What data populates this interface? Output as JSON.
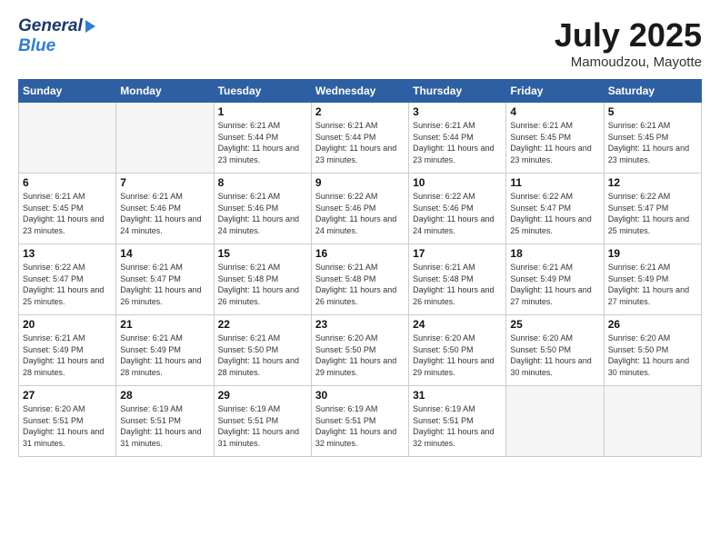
{
  "header": {
    "logo_general": "General",
    "logo_blue": "Blue",
    "month": "July 2025",
    "location": "Mamoudzou, Mayotte"
  },
  "days_of_week": [
    "Sunday",
    "Monday",
    "Tuesday",
    "Wednesday",
    "Thursday",
    "Friday",
    "Saturday"
  ],
  "weeks": [
    [
      {
        "day": "",
        "info": "",
        "empty": true
      },
      {
        "day": "",
        "info": "",
        "empty": true
      },
      {
        "day": "1",
        "info": "Sunrise: 6:21 AM\nSunset: 5:44 PM\nDaylight: 11 hours and 23 minutes."
      },
      {
        "day": "2",
        "info": "Sunrise: 6:21 AM\nSunset: 5:44 PM\nDaylight: 11 hours and 23 minutes."
      },
      {
        "day": "3",
        "info": "Sunrise: 6:21 AM\nSunset: 5:44 PM\nDaylight: 11 hours and 23 minutes."
      },
      {
        "day": "4",
        "info": "Sunrise: 6:21 AM\nSunset: 5:45 PM\nDaylight: 11 hours and 23 minutes."
      },
      {
        "day": "5",
        "info": "Sunrise: 6:21 AM\nSunset: 5:45 PM\nDaylight: 11 hours and 23 minutes."
      }
    ],
    [
      {
        "day": "6",
        "info": "Sunrise: 6:21 AM\nSunset: 5:45 PM\nDaylight: 11 hours and 23 minutes."
      },
      {
        "day": "7",
        "info": "Sunrise: 6:21 AM\nSunset: 5:46 PM\nDaylight: 11 hours and 24 minutes."
      },
      {
        "day": "8",
        "info": "Sunrise: 6:21 AM\nSunset: 5:46 PM\nDaylight: 11 hours and 24 minutes."
      },
      {
        "day": "9",
        "info": "Sunrise: 6:22 AM\nSunset: 5:46 PM\nDaylight: 11 hours and 24 minutes."
      },
      {
        "day": "10",
        "info": "Sunrise: 6:22 AM\nSunset: 5:46 PM\nDaylight: 11 hours and 24 minutes."
      },
      {
        "day": "11",
        "info": "Sunrise: 6:22 AM\nSunset: 5:47 PM\nDaylight: 11 hours and 25 minutes."
      },
      {
        "day": "12",
        "info": "Sunrise: 6:22 AM\nSunset: 5:47 PM\nDaylight: 11 hours and 25 minutes."
      }
    ],
    [
      {
        "day": "13",
        "info": "Sunrise: 6:22 AM\nSunset: 5:47 PM\nDaylight: 11 hours and 25 minutes."
      },
      {
        "day": "14",
        "info": "Sunrise: 6:21 AM\nSunset: 5:47 PM\nDaylight: 11 hours and 26 minutes."
      },
      {
        "day": "15",
        "info": "Sunrise: 6:21 AM\nSunset: 5:48 PM\nDaylight: 11 hours and 26 minutes."
      },
      {
        "day": "16",
        "info": "Sunrise: 6:21 AM\nSunset: 5:48 PM\nDaylight: 11 hours and 26 minutes."
      },
      {
        "day": "17",
        "info": "Sunrise: 6:21 AM\nSunset: 5:48 PM\nDaylight: 11 hours and 26 minutes."
      },
      {
        "day": "18",
        "info": "Sunrise: 6:21 AM\nSunset: 5:49 PM\nDaylight: 11 hours and 27 minutes."
      },
      {
        "day": "19",
        "info": "Sunrise: 6:21 AM\nSunset: 5:49 PM\nDaylight: 11 hours and 27 minutes."
      }
    ],
    [
      {
        "day": "20",
        "info": "Sunrise: 6:21 AM\nSunset: 5:49 PM\nDaylight: 11 hours and 28 minutes."
      },
      {
        "day": "21",
        "info": "Sunrise: 6:21 AM\nSunset: 5:49 PM\nDaylight: 11 hours and 28 minutes."
      },
      {
        "day": "22",
        "info": "Sunrise: 6:21 AM\nSunset: 5:50 PM\nDaylight: 11 hours and 28 minutes."
      },
      {
        "day": "23",
        "info": "Sunrise: 6:20 AM\nSunset: 5:50 PM\nDaylight: 11 hours and 29 minutes."
      },
      {
        "day": "24",
        "info": "Sunrise: 6:20 AM\nSunset: 5:50 PM\nDaylight: 11 hours and 29 minutes."
      },
      {
        "day": "25",
        "info": "Sunrise: 6:20 AM\nSunset: 5:50 PM\nDaylight: 11 hours and 30 minutes."
      },
      {
        "day": "26",
        "info": "Sunrise: 6:20 AM\nSunset: 5:50 PM\nDaylight: 11 hours and 30 minutes."
      }
    ],
    [
      {
        "day": "27",
        "info": "Sunrise: 6:20 AM\nSunset: 5:51 PM\nDaylight: 11 hours and 31 minutes."
      },
      {
        "day": "28",
        "info": "Sunrise: 6:19 AM\nSunset: 5:51 PM\nDaylight: 11 hours and 31 minutes."
      },
      {
        "day": "29",
        "info": "Sunrise: 6:19 AM\nSunset: 5:51 PM\nDaylight: 11 hours and 31 minutes."
      },
      {
        "day": "30",
        "info": "Sunrise: 6:19 AM\nSunset: 5:51 PM\nDaylight: 11 hours and 32 minutes."
      },
      {
        "day": "31",
        "info": "Sunrise: 6:19 AM\nSunset: 5:51 PM\nDaylight: 11 hours and 32 minutes."
      },
      {
        "day": "",
        "info": "",
        "empty": true
      },
      {
        "day": "",
        "info": "",
        "empty": true
      }
    ]
  ]
}
